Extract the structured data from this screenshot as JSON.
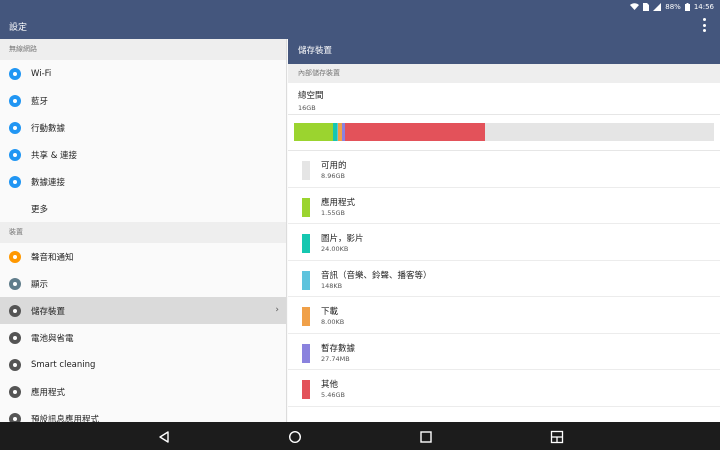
{
  "status_bar": {
    "battery": "88%",
    "time": "14:56",
    "icons": [
      "wifi-icon",
      "sim-icon",
      "signal-icon",
      "battery-icon"
    ]
  },
  "app_bar": {
    "title": "設定",
    "menu_icon": "overflow-menu-icon"
  },
  "sidebar": {
    "sections": [
      {
        "header": "無線網路",
        "items": [
          {
            "label": "Wi-Fi",
            "icon": "wifi-icon",
            "color": "#2196f3"
          },
          {
            "label": "藍牙",
            "icon": "bluetooth-icon",
            "color": "#2196f3"
          },
          {
            "label": "行動數據",
            "icon": "data-usage-icon",
            "color": "#2196f3"
          },
          {
            "label": "共享 & 連接",
            "icon": "share-icon",
            "color": "#2196f3"
          },
          {
            "label": "數據連接",
            "icon": "more-network-icon",
            "color": "#2196f3"
          },
          {
            "label": "更多",
            "icon": "",
            "color": ""
          }
        ]
      },
      {
        "header": "裝置",
        "items": [
          {
            "label": "聲音和通知",
            "icon": "sound-icon",
            "color": "#ff9800"
          },
          {
            "label": "顯示",
            "icon": "display-icon",
            "color": "#607d8b"
          },
          {
            "label": "儲存裝置",
            "icon": "storage-icon",
            "color": "#555555",
            "selected": true
          },
          {
            "label": "電池與省電",
            "icon": "battery-icon",
            "color": "#555555"
          },
          {
            "label": "Smart cleaning",
            "icon": "smart-cleaning-icon",
            "color": "#555555"
          },
          {
            "label": "應用程式",
            "icon": "apps-icon",
            "color": "#555555"
          },
          {
            "label": "預設訊息應用程式",
            "icon": "messaging-icon",
            "color": "#555555"
          }
        ]
      }
    ]
  },
  "detail": {
    "title": "儲存裝置",
    "subheader": "內部儲存裝置",
    "total_label": "總空間",
    "total_value": "16GB",
    "bar_fractions": [
      0.0938,
      0.0076,
      0.0038,
      0.0095,
      0.0029,
      0.0029,
      0.3336
    ],
    "bar_colors": [
      "#9bd42f",
      "#15c7b0",
      "#5ec3dd",
      "#f0a048",
      "#8a82de",
      "#8a82de",
      "#e3525a"
    ],
    "categories": [
      {
        "name": "可用的",
        "size": "8.96GB",
        "color": "#e5e5e5"
      },
      {
        "name": "應用程式",
        "size": "1.55GB",
        "color": "#9bd42f"
      },
      {
        "name": "圖片，影片",
        "size": "24.00KB",
        "color": "#15c7b0"
      },
      {
        "name": "音訊（音樂、鈴聲、播客等）",
        "size": "148KB",
        "color": "#5ec3dd"
      },
      {
        "name": "下載",
        "size": "8.00KB",
        "color": "#f0a048"
      },
      {
        "name": "暫存數據",
        "size": "27.74MB",
        "color": "#8a82de"
      },
      {
        "name": "其他",
        "size": "5.46GB",
        "color": "#e3525a"
      }
    ]
  },
  "nav_bar": {
    "buttons": [
      "back-icon",
      "home-icon",
      "recents-icon",
      "multiwindow-icon"
    ]
  }
}
